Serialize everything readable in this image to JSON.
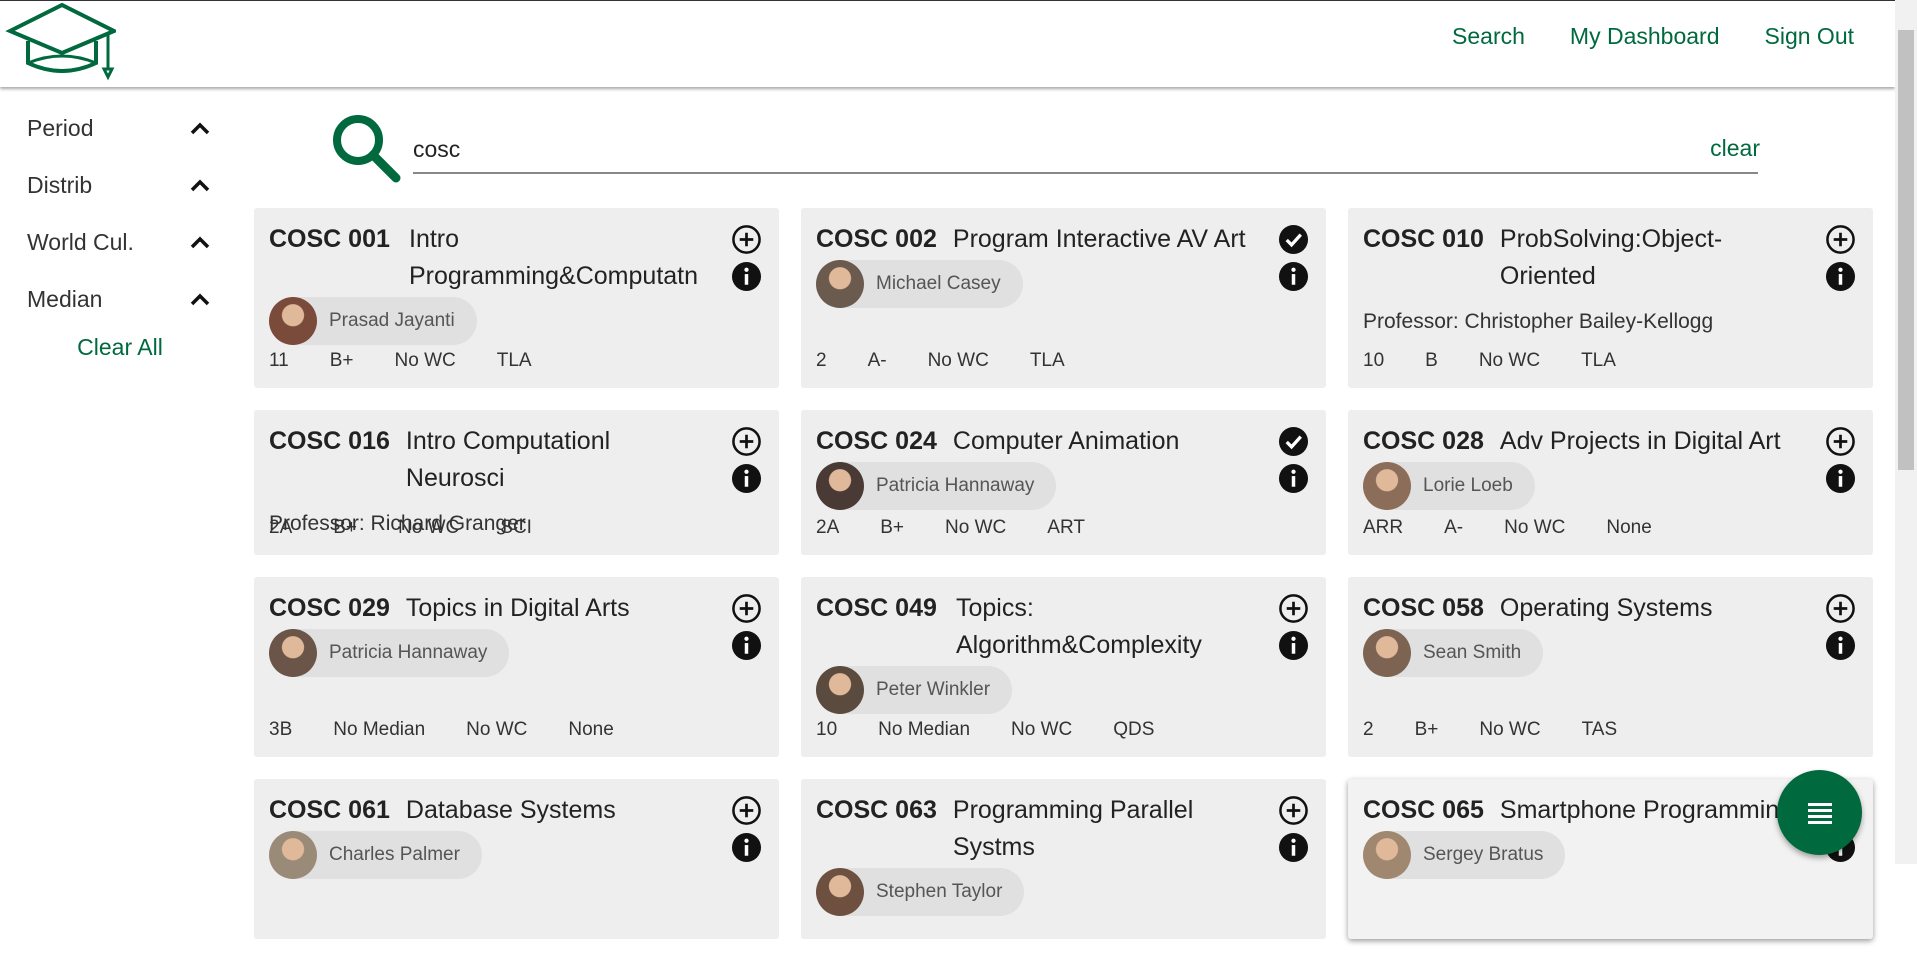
{
  "nav": {
    "search": "Search",
    "dashboard": "My Dashboard",
    "signout": "Sign Out"
  },
  "colors": {
    "accent": "#00693e",
    "card_bg": "#eeeeee"
  },
  "filters": [
    {
      "label": "Period"
    },
    {
      "label": "Distrib"
    },
    {
      "label": "World Cul."
    },
    {
      "label": "Median"
    }
  ],
  "clear_all": "Clear All",
  "search": {
    "value": "cosc",
    "clear": "clear"
  },
  "courses": [
    {
      "code": "COSC 001",
      "name": "Intro Programming&Computatn",
      "prof": "Prasad Jayanti",
      "stats": [
        "11",
        "B+",
        "No WC",
        "TLA"
      ],
      "added": false,
      "photo": true
    },
    {
      "code": "COSC 002",
      "name": "Program Interactive AV Art",
      "prof": "Michael Casey",
      "stats": [
        "2",
        "A-",
        "No WC",
        "TLA"
      ],
      "added": true,
      "photo": true
    },
    {
      "code": "COSC 010",
      "name": "ProbSolving:Object-Oriented",
      "prof": "Professor: Christopher Bailey-Kellogg",
      "stats": [
        "10",
        "B",
        "No WC",
        "TLA"
      ],
      "added": false,
      "photo": false
    },
    {
      "code": "COSC 016",
      "name": "Intro Computationl Neurosci",
      "prof": "Professor: Richard Granger",
      "stats": [
        "2A",
        "B+",
        "No WC",
        "SCI"
      ],
      "added": false,
      "photo": false
    },
    {
      "code": "COSC 024",
      "name": "Computer Animation",
      "prof": "Patricia Hannaway",
      "stats": [
        "2A",
        "B+",
        "No WC",
        "ART"
      ],
      "added": true,
      "photo": true
    },
    {
      "code": "COSC 028",
      "name": "Adv Projects in Digital Art",
      "prof": "Lorie Loeb",
      "stats": [
        "ARR",
        "A-",
        "No WC",
        "None"
      ],
      "added": false,
      "photo": true
    },
    {
      "code": "COSC 029",
      "name": "Topics in Digital Arts",
      "prof": "Patricia Hannaway",
      "stats": [
        "3B",
        "No Median",
        "No WC",
        "None"
      ],
      "added": false,
      "photo": true
    },
    {
      "code": "COSC 049",
      "name": "Topics: Algorithm&Complexity",
      "prof": "Peter Winkler",
      "stats": [
        "10",
        "No Median",
        "No WC",
        "QDS"
      ],
      "added": false,
      "photo": true
    },
    {
      "code": "COSC 058",
      "name": "Operating Systems",
      "prof": "Sean Smith",
      "stats": [
        "2",
        "B+",
        "No WC",
        "TAS"
      ],
      "added": false,
      "photo": true
    },
    {
      "code": "COSC 061",
      "name": "Database Systems",
      "prof": "Charles Palmer",
      "stats": [],
      "added": false,
      "photo": true
    },
    {
      "code": "COSC 063",
      "name": "Programming Parallel Systms",
      "prof": "Stephen Taylor",
      "stats": [],
      "added": false,
      "photo": true
    },
    {
      "code": "COSC 065",
      "name": "Smartphone Programming",
      "prof": "Sergey Bratus",
      "stats": [],
      "added": false,
      "photo": true
    }
  ]
}
